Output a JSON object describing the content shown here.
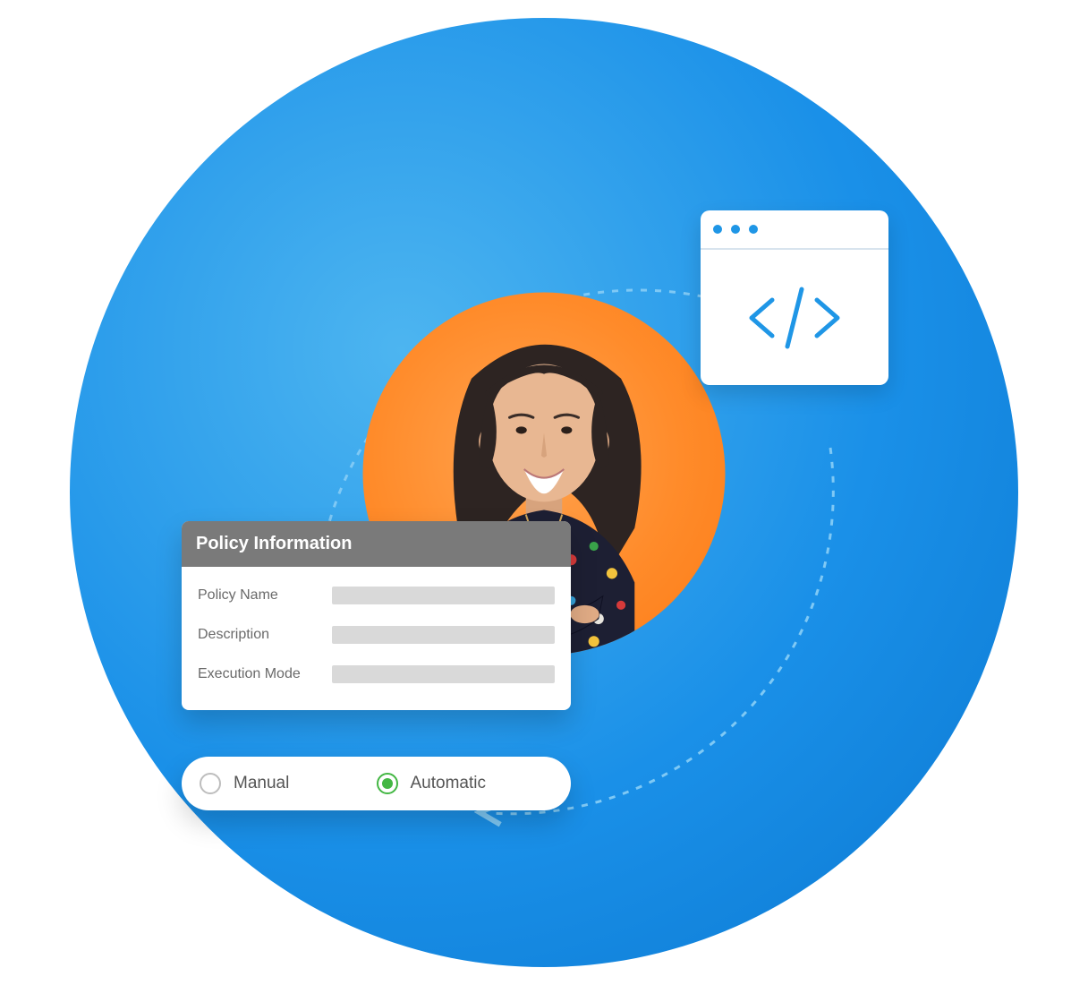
{
  "codeWindow": {
    "icon_name": "code-window-icon"
  },
  "policyCard": {
    "title": "Policy Information",
    "fields": [
      {
        "label": "Policy Name",
        "value": ""
      },
      {
        "label": "Description",
        "value": ""
      },
      {
        "label": "Execution Mode",
        "value": ""
      }
    ]
  },
  "modeOptions": {
    "options": [
      {
        "label": "Manual",
        "selected": false
      },
      {
        "label": "Automatic",
        "selected": true
      }
    ]
  },
  "colors": {
    "blue": "#1f96e6",
    "orange": "#ff8b2a",
    "green": "#43b743",
    "headerGray": "#7a7a7a"
  }
}
